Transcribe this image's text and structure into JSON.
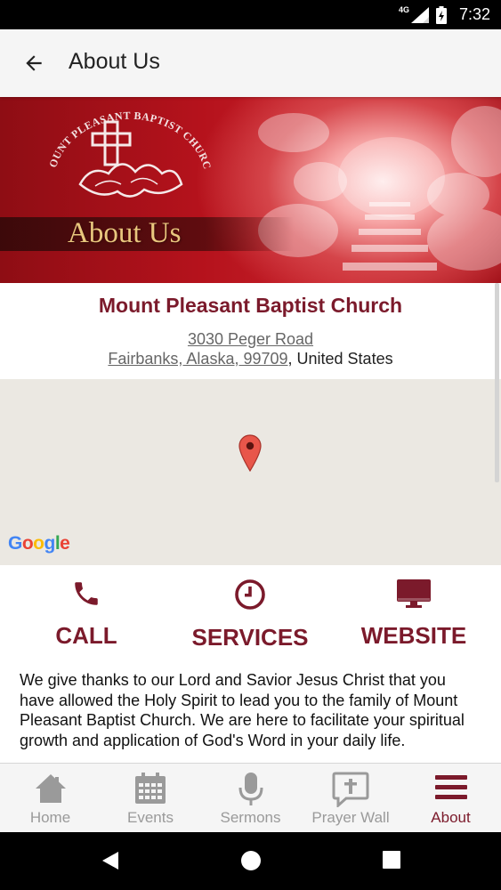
{
  "status_bar": {
    "network": "4G",
    "time": "7:32"
  },
  "app_bar": {
    "title": "About Us"
  },
  "banner": {
    "logo_text": "MOUNT PLEASANT BAPTIST CHURCH",
    "title": "About Us"
  },
  "church": {
    "name": "Mount Pleasant Baptist Church",
    "street": "3030 Peger Road",
    "city_state_zip": "Fairbanks, Alaska, 99709",
    "country_suffix": ", United States"
  },
  "map": {
    "attribution": "Google"
  },
  "actions": [
    {
      "label": "CALL",
      "icon": "phone-icon"
    },
    {
      "label": "SERVICES",
      "icon": "clock-icon"
    },
    {
      "label": "WEBSITE",
      "icon": "monitor-icon"
    }
  ],
  "description": "We give thanks to our Lord and Savior Jesus Christ that you have allowed the Holy Spirit to lead you to the family of Mount Pleasant Baptist Church.  We are here to facilitate your spiritual growth and application of God's Word in your daily life.",
  "bottom_nav": {
    "active": "About",
    "items": [
      {
        "label": "Home",
        "icon": "home-icon"
      },
      {
        "label": "Events",
        "icon": "calendar-icon"
      },
      {
        "label": "Sermons",
        "icon": "microphone-icon"
      },
      {
        "label": "Prayer Wall",
        "icon": "prayer-bubble-icon"
      },
      {
        "label": "About",
        "icon": "menu-icon"
      }
    ]
  },
  "colors": {
    "accent": "#7b1a2b",
    "nav_inactive": "#9a9a9a",
    "banner_red": "#b5121c",
    "banner_gold_text": "#e9c77e",
    "map_background": "#ebe8e2"
  }
}
